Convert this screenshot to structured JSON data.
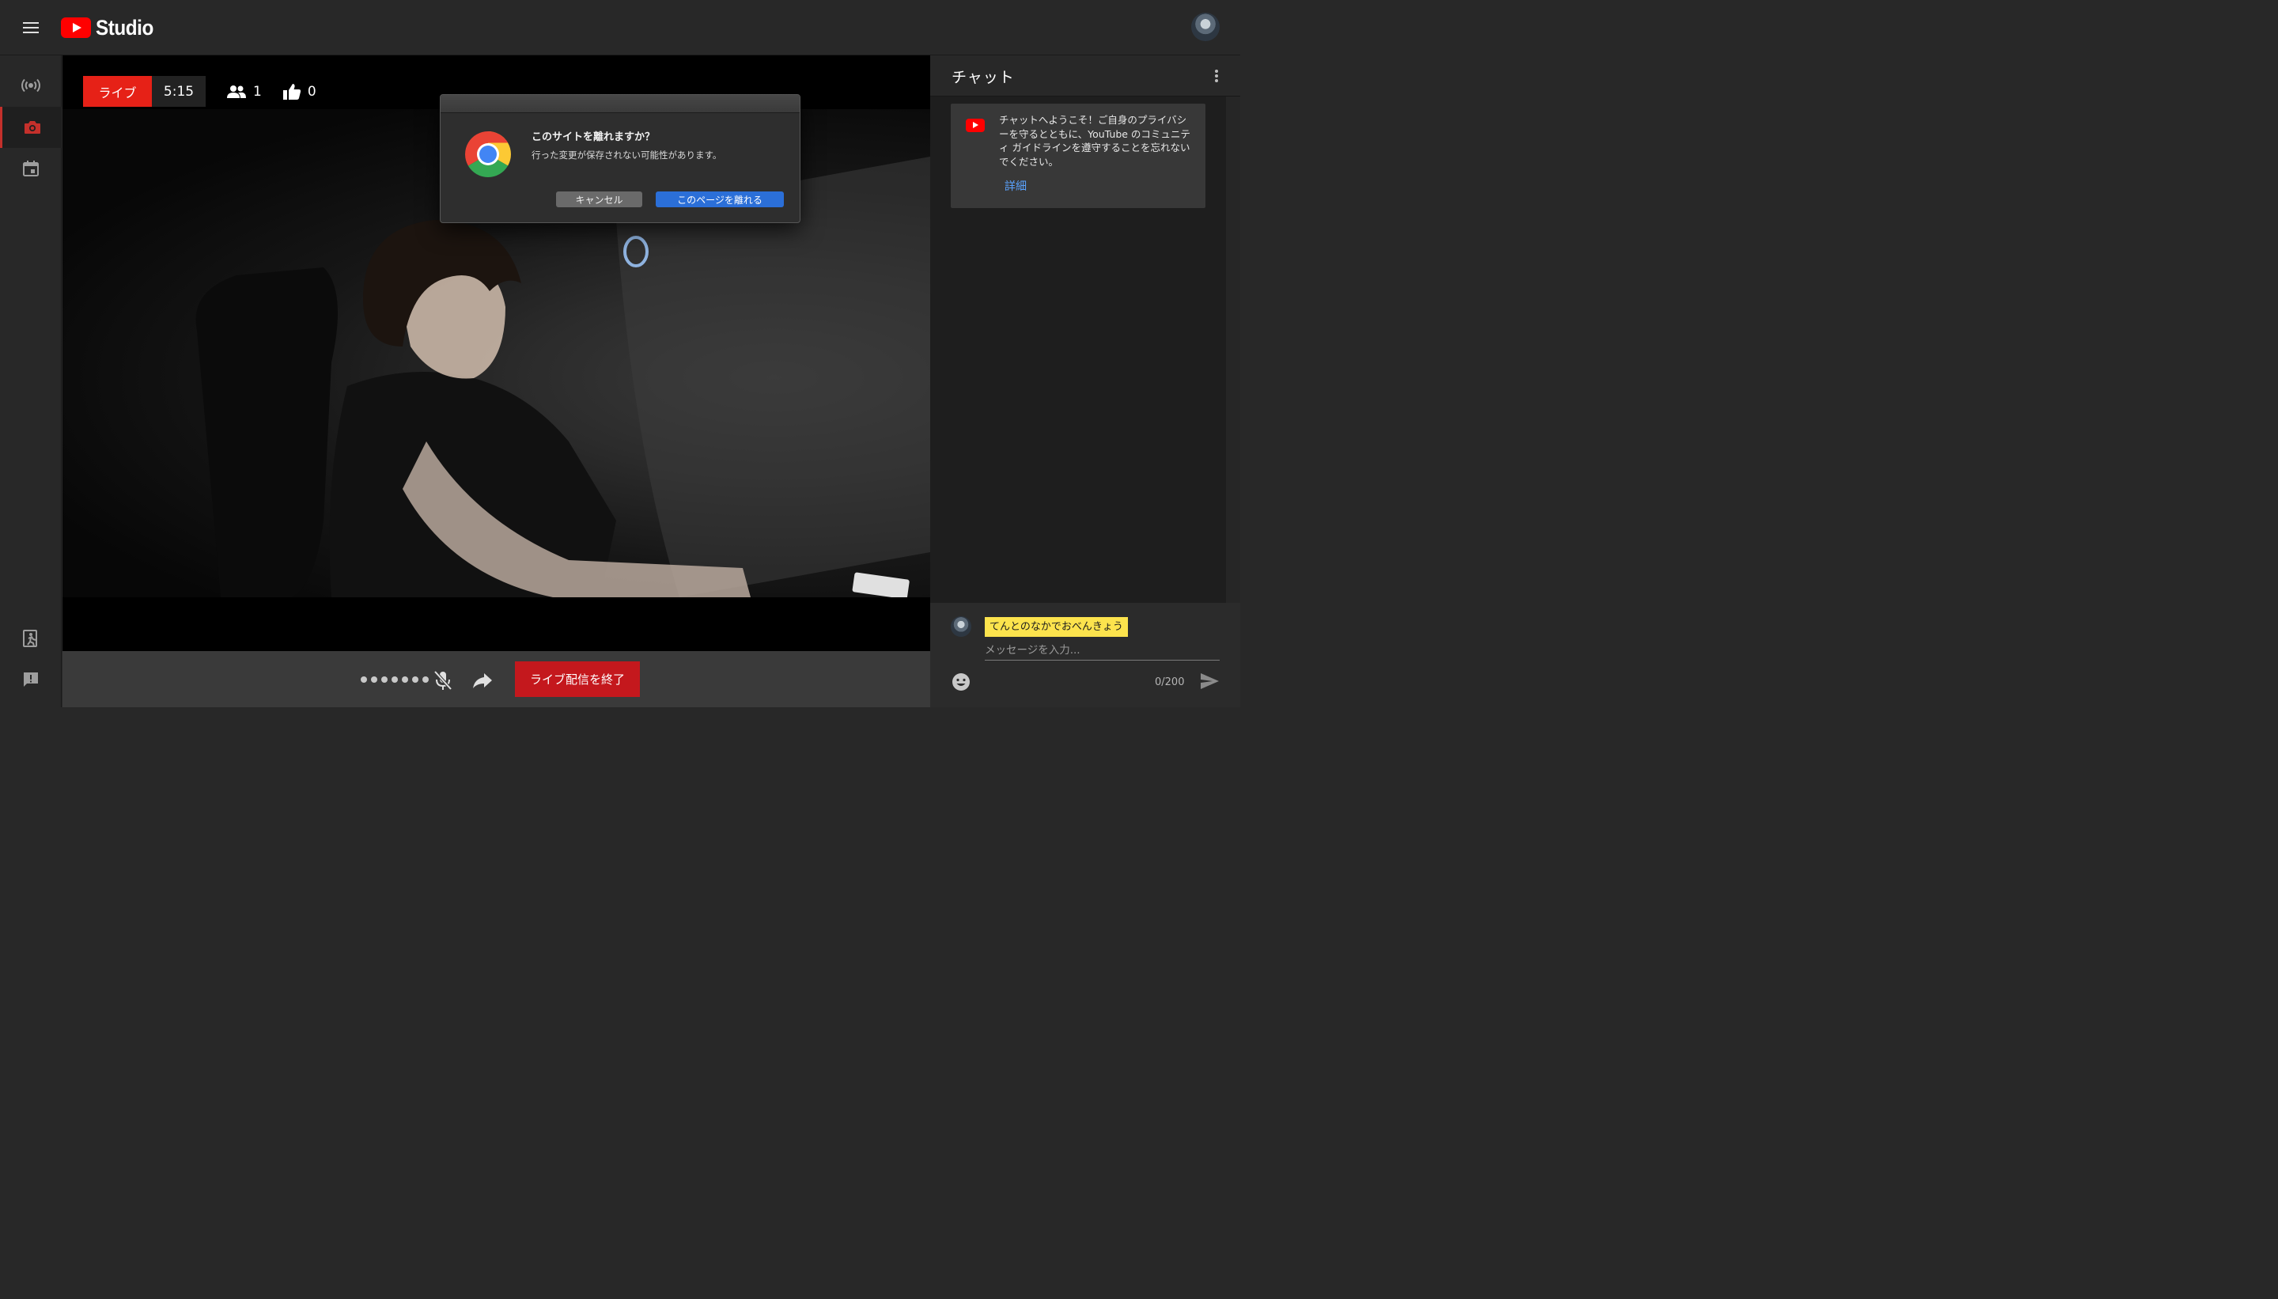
{
  "app": {
    "logo_text": "Studio"
  },
  "stream": {
    "live_label": "ライブ",
    "duration": "5:15",
    "viewers": "1",
    "likes": "0",
    "end_button_label": "ライブ配信を終了"
  },
  "chat": {
    "title": "チャット",
    "welcome_message": "チャットへようこそ！ご自身のプライバシーを守るとともに、YouTube のコミュニティ ガイドラインを遵守することを忘れないでください。",
    "welcome_link": "詳細",
    "user_name": "てんとのなかでおべんきょう",
    "input_placeholder": "メッセージを入力...",
    "char_count": "0/200"
  },
  "dialog": {
    "title": "このサイトを離れますか？",
    "message": "行った変更が保存されない可能性があります。",
    "cancel_label": "キャンセル",
    "confirm_label": "このページを離れる"
  },
  "colors": {
    "live_red": "#e62117",
    "end_button_red": "#c4181d",
    "brand_red": "#ff0000",
    "link_blue": "#5aa3ff",
    "dialog_primary_blue": "#2b6fd8",
    "name_highlight_yellow": "#fce34d"
  },
  "icons": {
    "rail": [
      "live-broadcast-icon",
      "webcam-icon",
      "calendar-icon",
      "exit-studio-icon",
      "feedback-icon"
    ],
    "stream_controls": [
      "mic-off-icon",
      "share-icon"
    ],
    "chat": [
      "emoji-icon",
      "send-icon",
      "more-options-icon"
    ]
  }
}
